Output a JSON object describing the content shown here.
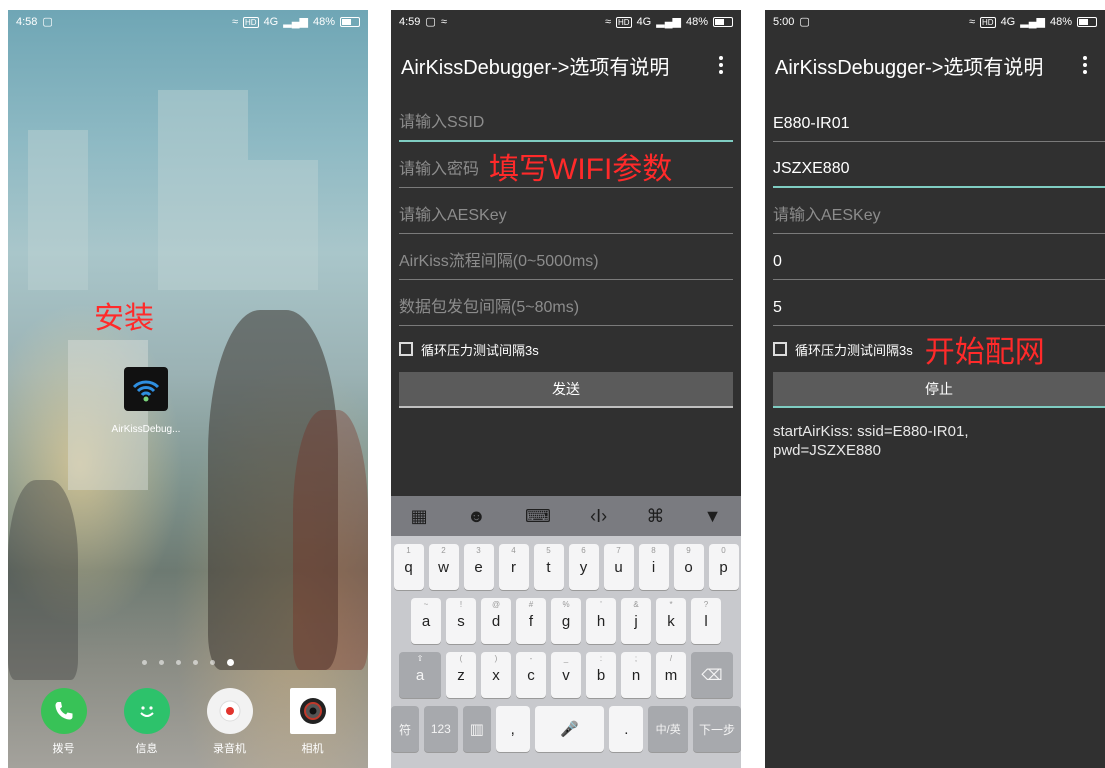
{
  "colors": {
    "annotation_red": "#ff2a2a",
    "dark_bg": "#303030",
    "accent_teal": "#7fcdc2",
    "wechat_green": "#2dc26b",
    "phone_green": "#38c257"
  },
  "home": {
    "status": {
      "time": "4:58",
      "network": "HD",
      "signal": "4G",
      "battery": "48%"
    },
    "annotation": "安装",
    "app_label": "AirKissDebug...",
    "dock": [
      {
        "label": "拨号",
        "icon": "phone-icon"
      },
      {
        "label": "信息",
        "icon": "message-icon"
      },
      {
        "label": "录音机",
        "icon": "recorder-icon"
      },
      {
        "label": "相机",
        "icon": "camera-icon"
      }
    ]
  },
  "form_screen": {
    "status": {
      "time": "4:59",
      "network": "HD",
      "signal": "4G",
      "battery": "48%"
    },
    "title": "AirKissDebugger->选项有说明",
    "ssid_placeholder": "请输入SSID",
    "password_placeholder": "请输入密码",
    "annotation": "填写WIFI参数",
    "aeskey_placeholder": "请输入AESKey",
    "interval_placeholder": "AirKiss流程间隔(0~5000ms)",
    "packet_placeholder": "数据包发包间隔(5~80ms)",
    "checkbox_label": "循环压力测试间隔3s",
    "send_label": "发送",
    "keyboard": {
      "row1": [
        "q",
        "w",
        "e",
        "r",
        "t",
        "y",
        "u",
        "i",
        "o",
        "p"
      ],
      "row1_sub": [
        "1",
        "2",
        "3",
        "4",
        "5",
        "6",
        "7",
        "8",
        "9",
        "0"
      ],
      "row2": [
        "a",
        "s",
        "d",
        "f",
        "g",
        "h",
        "j",
        "k",
        "l"
      ],
      "row2_sub": [
        "~",
        "!",
        "@",
        "#",
        "%",
        "'",
        "&",
        "*",
        "?"
      ],
      "row3": [
        "z",
        "x",
        "c",
        "v",
        "b",
        "n",
        "m"
      ],
      "row3_sub": [
        "(",
        ")",
        "-",
        "_",
        ":",
        ";",
        "/"
      ],
      "shift_label": "a",
      "symbol_label": "符",
      "num_label": "123",
      "comma": ",",
      "period": ".",
      "lang_label": "中/英",
      "next_label": "下一步"
    }
  },
  "running_screen": {
    "status": {
      "time": "5:00",
      "network": "HD",
      "signal": "4G",
      "battery": "48%"
    },
    "title": "AirKissDebugger->选项有说明",
    "ssid_value": "E880-IR01",
    "password_value": "JSZXE880",
    "aeskey_placeholder": "请输入AESKey",
    "interval_value": "0",
    "packet_value": "5",
    "checkbox_label": "循环压力测试间隔3s",
    "annotation": "开始配网",
    "stop_label": "停止",
    "log_line1": "startAirKiss: ssid=E880-IR01,",
    "log_line2": "pwd=JSZXE880"
  }
}
